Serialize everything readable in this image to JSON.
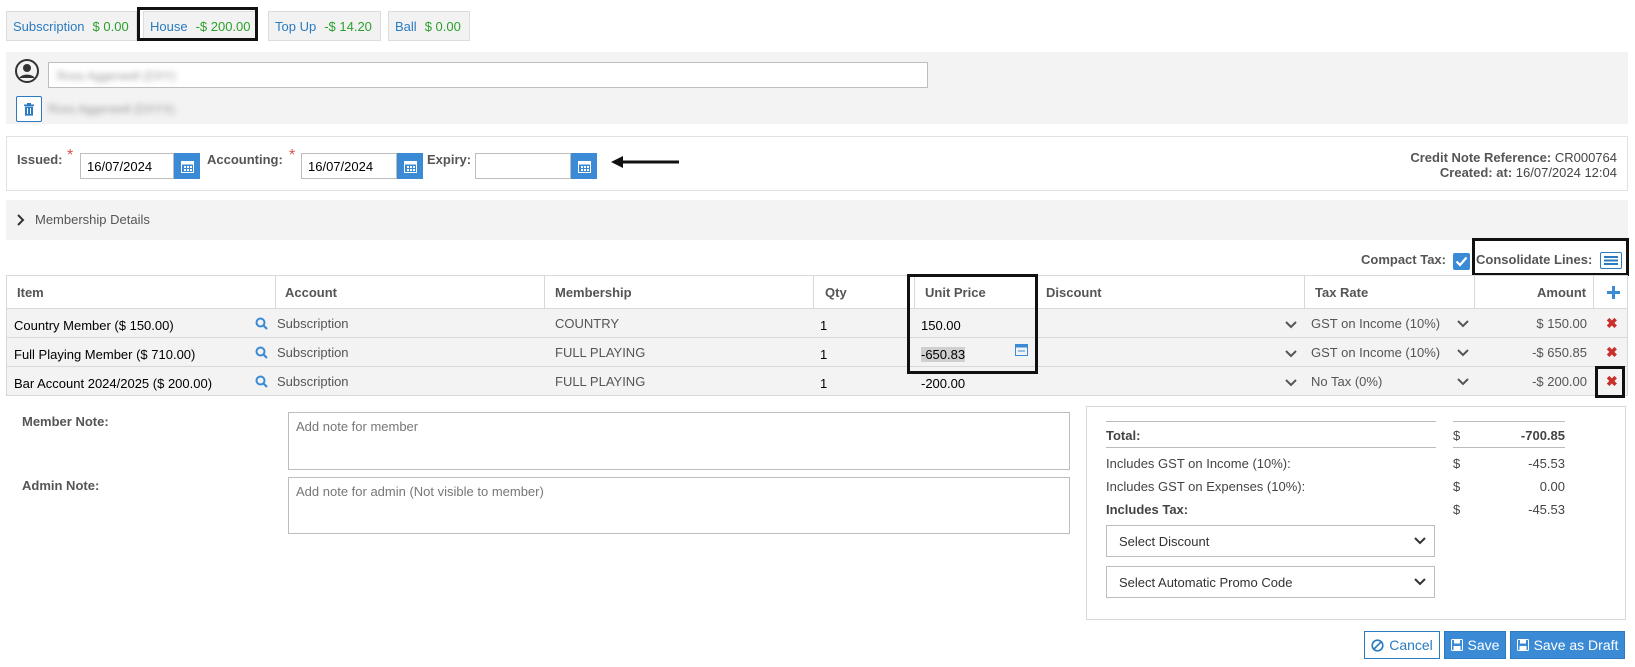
{
  "account_tabs": [
    {
      "name": "Subscription",
      "balance": "$ 0.00"
    },
    {
      "name": "House",
      "balance": "-$ 200.00"
    },
    {
      "name": "Top Up",
      "balance": "-$ 14.20"
    },
    {
      "name": "Ball",
      "balance": "$ 0.00"
    }
  ],
  "member": {
    "search_value": "Ross Aggerwell (DXY)",
    "selected_member": "Ross Aggerwell (DXYX)"
  },
  "dates": {
    "issued_label": "Issued:",
    "issued_value": "16/07/2024",
    "accounting_label": "Accounting:",
    "accounting_value": "16/07/2024",
    "expiry_label": "Expiry:",
    "expiry_value": "",
    "required_mark": "*"
  },
  "credit_note": {
    "reference_label": "Credit Note Reference:",
    "reference_value": "CR000764",
    "created_label": "Created:",
    "created_at_label": "at:",
    "created_value": "16/07/2024 12:04"
  },
  "membership_details_label": "Membership Details",
  "options": {
    "compact_tax_label": "Compact Tax:",
    "compact_tax_checked": true,
    "consolidate_lines_label": "Consolidate Lines:"
  },
  "table": {
    "headers": {
      "item": "Item",
      "account": "Account",
      "membership": "Membership",
      "qty": "Qty",
      "unit_price": "Unit Price",
      "discount": "Discount",
      "tax_rate": "Tax Rate",
      "amount": "Amount"
    },
    "rows": [
      {
        "item": "Country Member ($ 150.00)",
        "account": "Subscription",
        "membership": "COUNTRY",
        "qty": "1",
        "unit_price": "150.00",
        "discount": "",
        "tax_rate": "GST on Income (10%)",
        "amount": "$ 150.00"
      },
      {
        "item": "Full Playing Member ($ 710.00)",
        "account": "Subscription",
        "membership": "FULL PLAYING",
        "qty": "1",
        "unit_price": "-650.83",
        "discount": "",
        "tax_rate": "GST on Income (10%)",
        "amount": "-$ 650.85"
      },
      {
        "item": "Bar Account 2024/2025 ($ 200.00)",
        "account": "Subscription",
        "membership": "FULL PLAYING",
        "qty": "1",
        "unit_price": "-200.00",
        "discount": "",
        "tax_rate": "No Tax (0%)",
        "amount": "-$ 200.00"
      }
    ]
  },
  "notes": {
    "member_label": "Member Note:",
    "member_placeholder": "Add note for member",
    "admin_label": "Admin Note:",
    "admin_placeholder": "Add note for admin (Not visible to member)"
  },
  "totals": {
    "currency": "$",
    "total_label": "Total:",
    "total_value": "-700.85",
    "gst_income_label": "Includes GST on Income (10%):",
    "gst_income_value": "-45.53",
    "gst_expenses_label": "Includes GST on Expenses (10%):",
    "gst_expenses_value": "0.00",
    "includes_tax_label": "Includes Tax:",
    "includes_tax_value": "-45.53",
    "discount_select": "Select Discount",
    "promo_select": "Select Automatic Promo Code"
  },
  "actions": {
    "cancel": "Cancel",
    "save": "Save",
    "save_draft": "Save as Draft"
  },
  "colors": {
    "link_blue": "#2a7bc0",
    "balance_green": "#2ca02c",
    "danger_red": "#c9302c",
    "primary_button": "#3a8ad6"
  }
}
